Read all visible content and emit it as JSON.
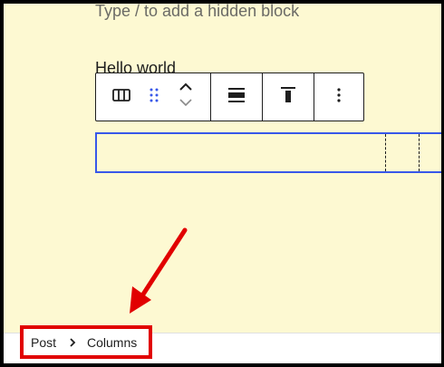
{
  "editor": {
    "placeholder": "Type / to add a hidden block",
    "heading": "Hello world"
  },
  "toolbar": {
    "block_type_icon": "columns-icon",
    "drag_icon": "drag-handle-icon",
    "move_up_icon": "chevron-up-icon",
    "move_down_icon": "chevron-down-icon",
    "align_icon": "align-wide-icon",
    "vertical_align_icon": "vertical-align-top-icon",
    "more_icon": "more-vertical-icon"
  },
  "breadcrumb": {
    "items": [
      "Post",
      "Columns"
    ]
  },
  "colors": {
    "canvas": "#fdf9d2",
    "selection": "#3858e9",
    "annotation": "#e10000"
  }
}
